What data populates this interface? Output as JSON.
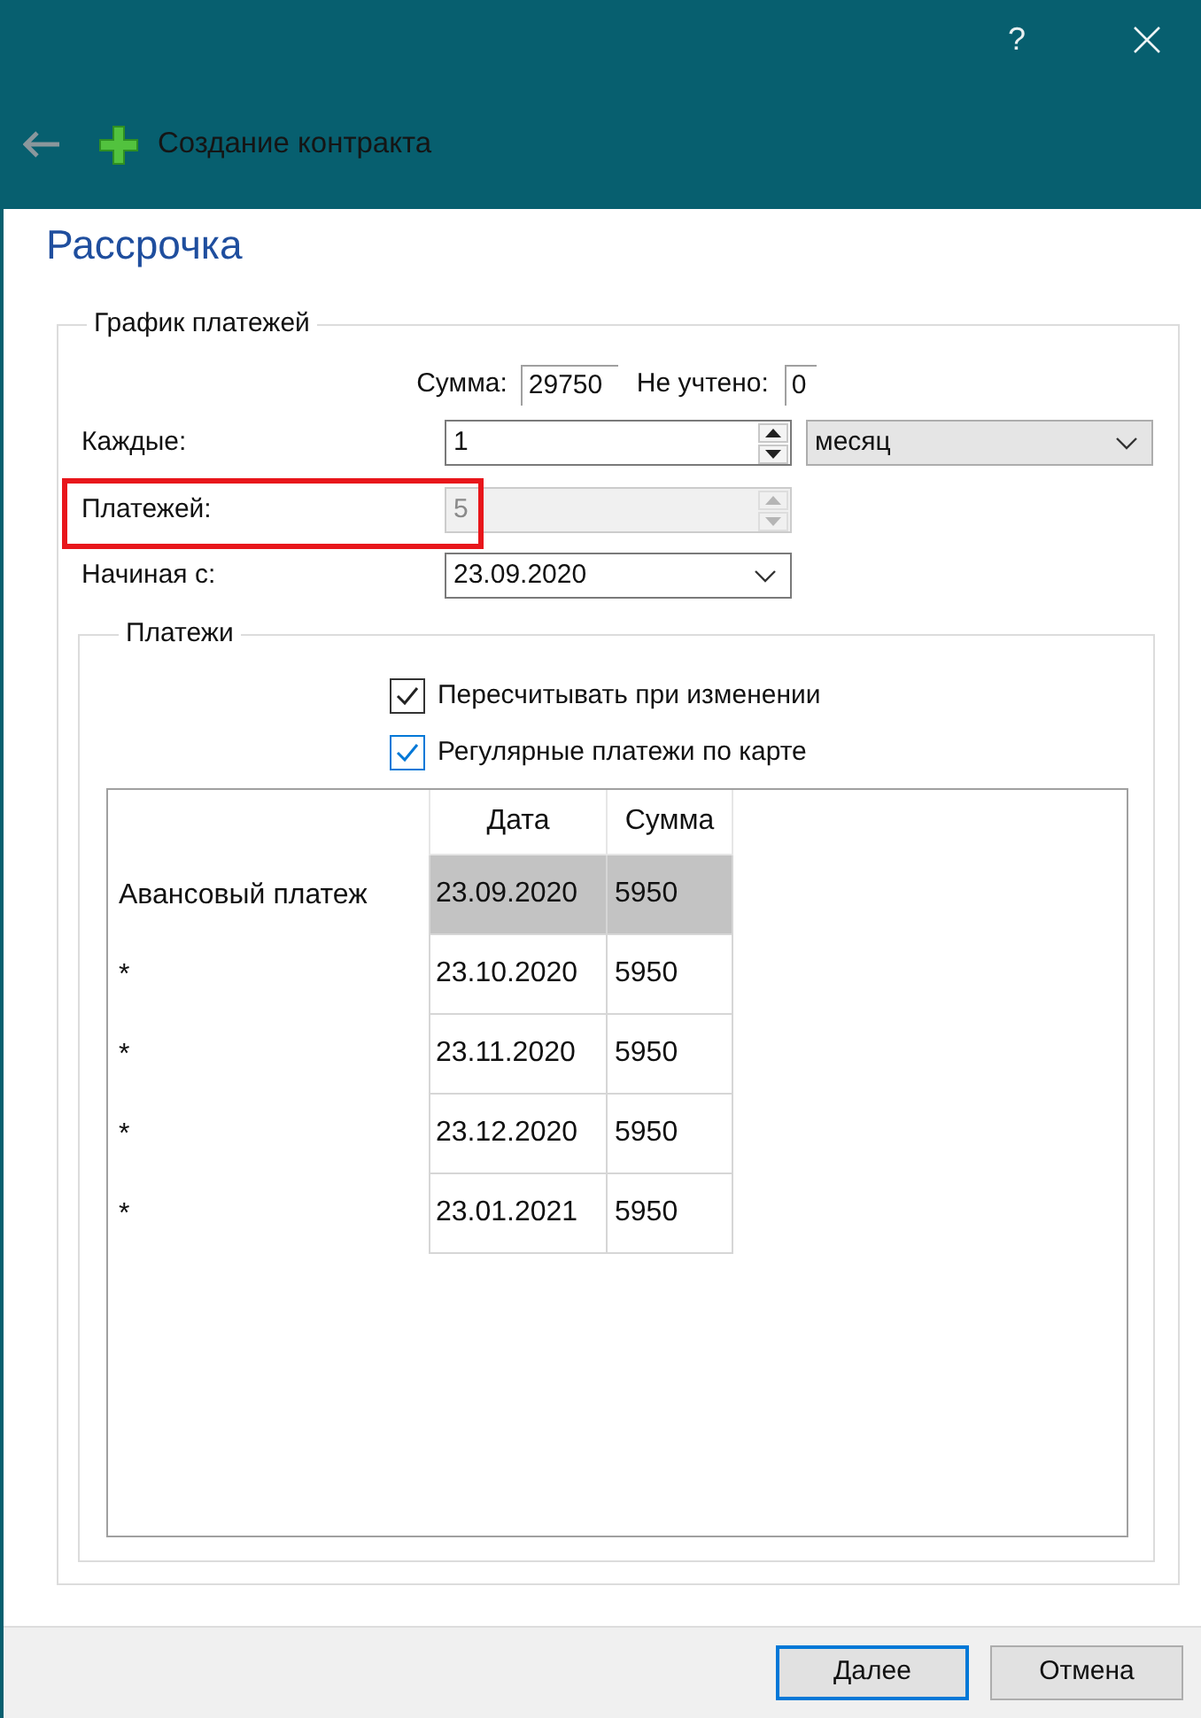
{
  "window": {
    "help": "?"
  },
  "header": {
    "title": "Создание контракта"
  },
  "page_title": "Рассрочка",
  "schedule": {
    "title": "График платежей",
    "sum_label": "Сумма:",
    "sum_value": "29750",
    "unaccounted_label": "Не учтено:",
    "unaccounted_value": "0",
    "fields": [
      {
        "kind": "spin",
        "label": "Каждые:",
        "value": "1",
        "disabled": false,
        "highlighted": false,
        "unit": "месяц"
      },
      {
        "kind": "spin",
        "label": "Платежей:",
        "value": "5",
        "disabled": true,
        "highlighted": true
      },
      {
        "kind": "date",
        "label": "Начиная с:",
        "value": "23.09.2020",
        "disabled": false,
        "highlighted": false
      }
    ]
  },
  "payments": {
    "title": "Платежи",
    "options": [
      {
        "label": "Пересчитывать при изменении",
        "checked": true,
        "focused": false
      },
      {
        "label": "Регулярные платежи по карте",
        "checked": true,
        "focused": true
      }
    ],
    "columns": [
      "Дата",
      "Сумма"
    ],
    "rows": [
      {
        "label": "Авансовый платеж",
        "date": "23.09.2020",
        "amount": "5950",
        "selected": true
      },
      {
        "label": "*",
        "date": "23.10.2020",
        "amount": "5950",
        "selected": false
      },
      {
        "label": "*",
        "date": "23.11.2020",
        "amount": "5950",
        "selected": false
      },
      {
        "label": "*",
        "date": "23.12.2020",
        "amount": "5950",
        "selected": false
      },
      {
        "label": "*",
        "date": "23.01.2021",
        "amount": "5950",
        "selected": false
      }
    ]
  },
  "buttons": [
    {
      "label": "Далее",
      "default": true
    },
    {
      "label": "Отмена",
      "default": false
    }
  ]
}
